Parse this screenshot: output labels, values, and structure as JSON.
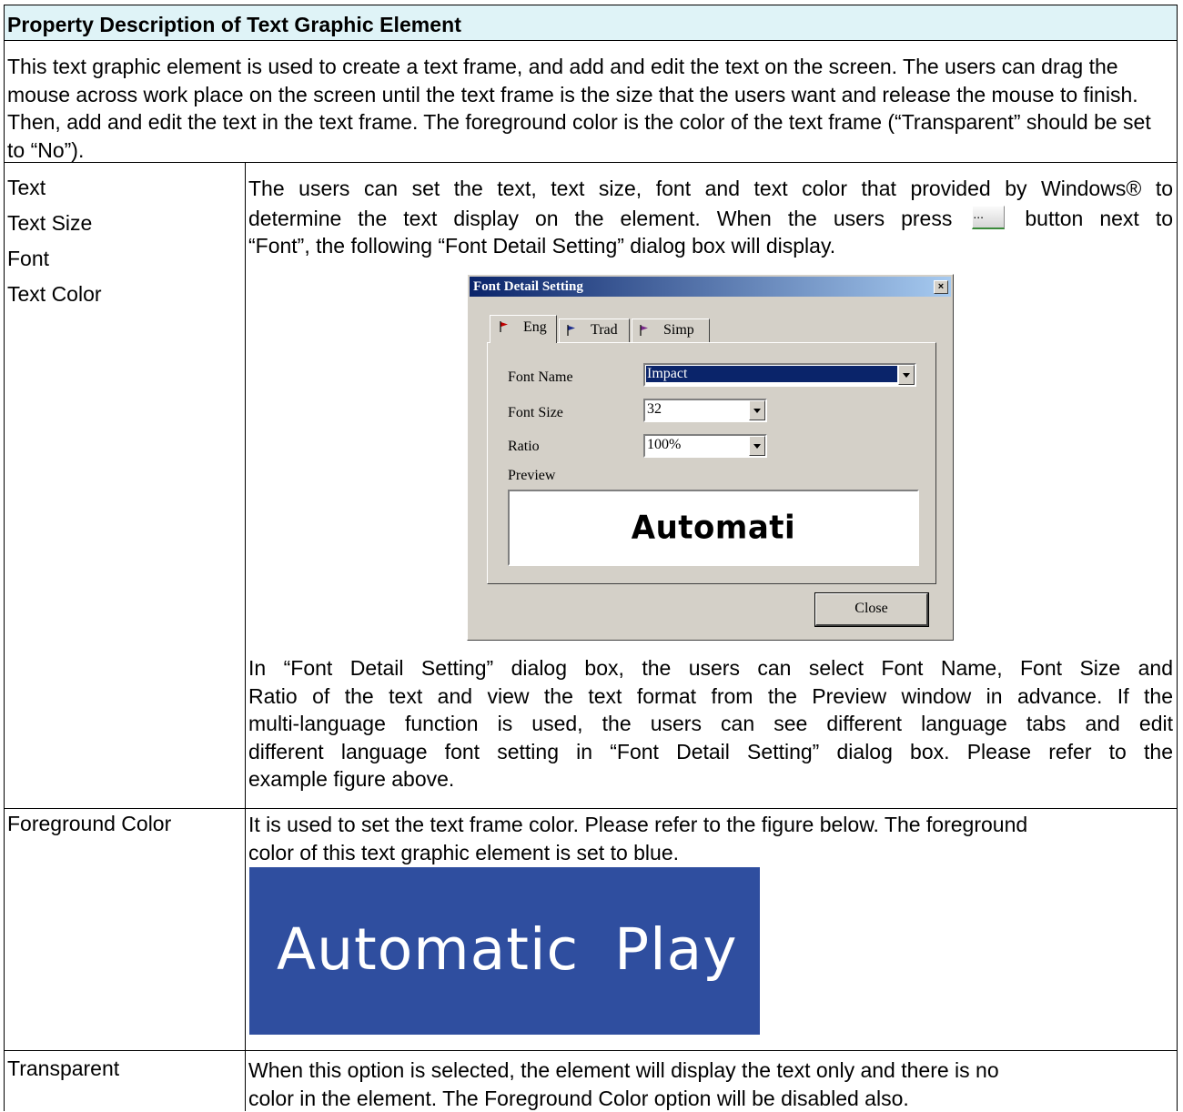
{
  "header": {
    "title": "Property Description of Text Graphic Element"
  },
  "intro": {
    "text": "This text graphic element is used to create a text frame, and add and edit the text on the screen. The users can drag the mouse across work place on the screen until the text frame is the size that the users want and release the mouse to finish. Then, add and edit the text in the text frame. The foreground color is the color of the text frame (“Transparent” should be set to “No”)."
  },
  "rows": {
    "text_row": {
      "props": [
        "Text",
        "Text Size",
        "Font",
        "Text Color"
      ],
      "desc_line1": "The users can set the text, text size, font and text color that provided by Windows® to",
      "desc_line2a": "determine the text display on the element. When the users press",
      "button_glyph": "...",
      "desc_line2b": "button next to",
      "desc_line3": "“Font”, the following “Font Detail Setting” dialog box will display.",
      "desc_after": [
        "In “Font Detail Setting” dialog box, the users can select Font Name, Font Size and",
        "Ratio of the text and view the text format from the Preview window in advance. If the",
        "multi-language function is used, the users can see different language tabs and edit",
        "different language font setting in “Font Detail Setting” dialog box. Please refer to the",
        "example figure above."
      ]
    },
    "foreground_row": {
      "prop": "Foreground Color",
      "desc": [
        "It is used to set the text frame color. Please refer to the figure below. The foreground",
        "color of this text graphic element is set to blue."
      ],
      "sample_text": "Automatic  Play",
      "sample_color": "#2f4e9f"
    },
    "transparent_row": {
      "prop": "Transparent",
      "desc": [
        "When this option is selected, the element will display the text only and there is no",
        "color in the element. The Foreground Color option will be disabled also."
      ]
    }
  },
  "dialog": {
    "title": "Font Detail Setting",
    "close_glyph": "×",
    "tabs": [
      {
        "label": "Eng",
        "flag_color": "#c00000",
        "icon": "flag-icon"
      },
      {
        "label": "Trad",
        "flag_color": "#1f2f8f",
        "icon": "flag-icon"
      },
      {
        "label": "Simp",
        "flag_color": "#7a2a8a",
        "icon": "flag-icon"
      }
    ],
    "font_name_label": "Font Name",
    "font_name_value": "Impact",
    "font_size_label": "Font Size",
    "font_size_value": "32",
    "ratio_label": "Ratio",
    "ratio_value": "100%",
    "preview_label": "Preview",
    "preview_text": "Automati",
    "close_button": "Close"
  },
  "colors": {
    "header_bg": "#dff3f7",
    "title_bar": "#0a246a",
    "dialog_bg": "#d4d0c8"
  }
}
